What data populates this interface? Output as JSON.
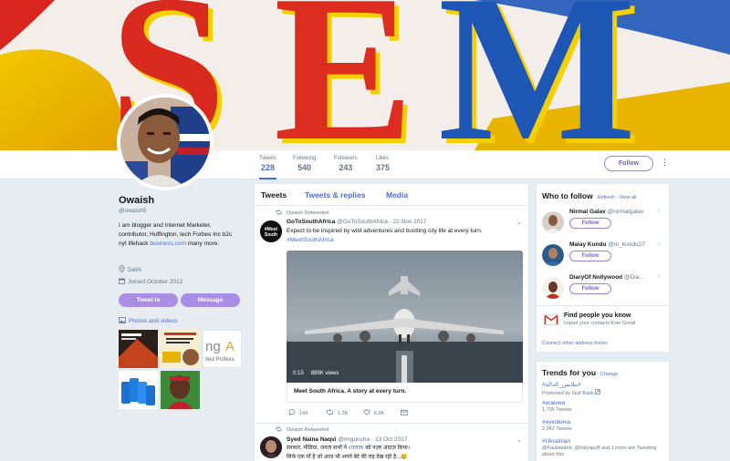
{
  "profile": {
    "name": "Owaish",
    "handle": "@owaish5",
    "bio_text": "I am blogger and Internet Marketer, contributor, Huffington, tech Forbes Inc b2c nyt lifehack ",
    "bio_link": "business.com",
    "bio_suffix": " many more.",
    "location": "Delhi",
    "joined": "Joined October 2012",
    "tweet_to_label": "Tweet to",
    "message_label": "Message",
    "photos_label": "Photos and videos"
  },
  "banner": {
    "letters": "SEM"
  },
  "stats": [
    {
      "label": "Tweets",
      "value": "228"
    },
    {
      "label": "Following",
      "value": "540"
    },
    {
      "label": "Followers",
      "value": "243"
    },
    {
      "label": "Likes",
      "value": "375"
    }
  ],
  "follow_label": "Follow",
  "more_label": "⋮",
  "tabs": {
    "tweets": "Tweets",
    "replies": "Tweets & replies",
    "media": "Media"
  },
  "tweets": [
    {
      "retweet_note": "Owaish Retweeted",
      "name": "GoToSouthAfrica",
      "handle": "@GoToSouthAfrica",
      "date": "· 22 Nov 2017",
      "text": "Expect to be inspired by wild adventures and bustling city life at every turn.",
      "hashtag": "#MeetSouthAfrica",
      "avatar_text": "Meet South Africa",
      "video_time": "0:15",
      "video_views": "889K views",
      "video_caption": "Meet South Africa. A story at every turn.",
      "replies": "149",
      "retweets": "1.2K",
      "likes": "6.8K"
    },
    {
      "retweet_note": "Owaish Retweeted",
      "name": "Syed Naina Naqvi",
      "handle": "@imguncha",
      "date": "· 13 Oct 2017",
      "text_line1_a": "सरकार, मीडिया, जनता सभी ने ",
      "text_line1_tag": "#तलाक",
      "text_line1_b": " को नज़र अंदाज़ किया।",
      "text_line2": "सिर्फ एक माँ है जो आज भी अपने बेटे की राह देख रही है...😢"
    }
  ],
  "who_to_follow": {
    "title": "Who to follow",
    "links": " · Refresh · View all",
    "users": [
      {
        "name": "Nirmal Galav",
        "handle": "@nirmalgalav",
        "button": "Follow"
      },
      {
        "name": "Malay Kundu",
        "handle": "@m_kundu27",
        "button": "Follow"
      },
      {
        "name": "DiaryOf Nollywood",
        "handle": "@Dia...",
        "button": "Follow"
      }
    ],
    "find_title": "Find people you know",
    "find_sub": "Import your contacts from Gmail",
    "connect": "Connect other address books",
    "close_icon": "×"
  },
  "trends": {
    "title": "Trends for you",
    "change": " · Change",
    "items": [
      {
        "name": "#ملابس_الدالة#",
        "sub": "Promoted by Gulf Bank"
      },
      {
        "name": "#новини",
        "sub": "1,735 Tweets"
      },
      {
        "name": "#нуковича",
        "sub": "2,342 Tweets"
      },
      {
        "name": "#Ukrainian",
        "sub": "@Faulstalent, @halyapuff and 1 more are Tweeting about this"
      }
    ]
  },
  "colors": {
    "accent": "#4a6dd8",
    "button": "#a98ee6",
    "follow_border": "#9f7fe0"
  }
}
